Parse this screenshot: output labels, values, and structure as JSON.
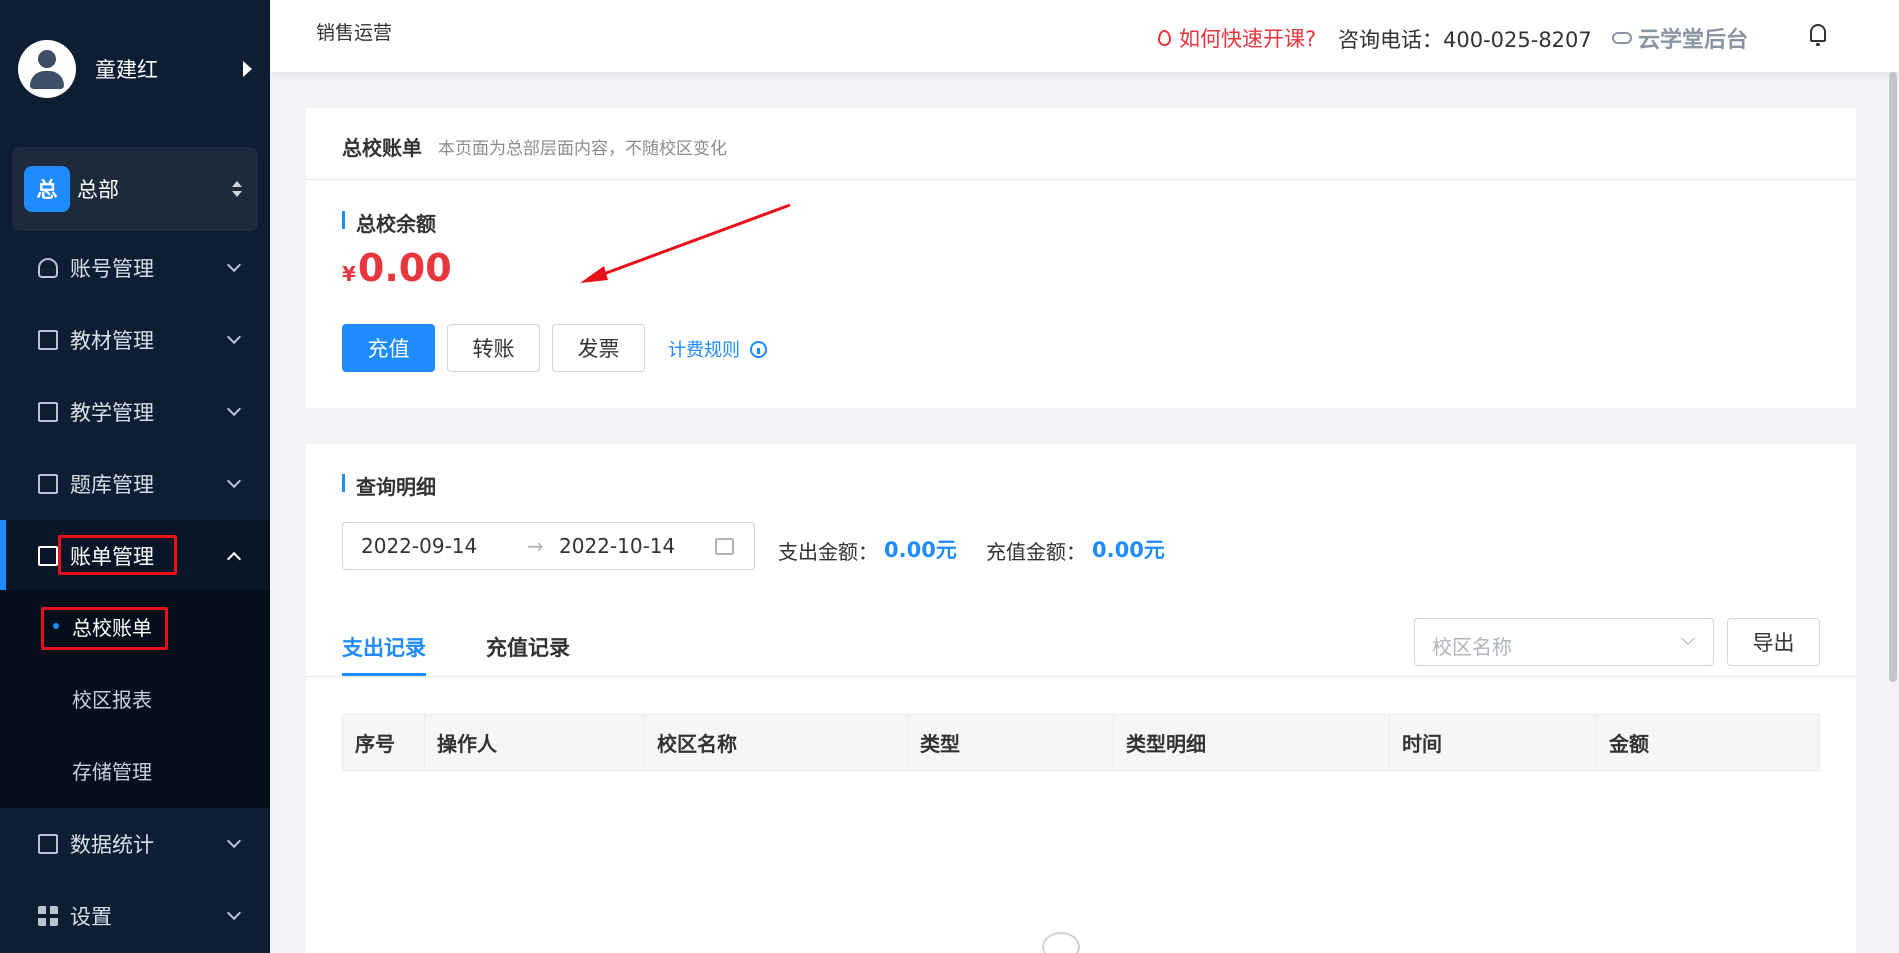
{
  "sidebar": {
    "user_name": "童建红",
    "org": {
      "badge": "总",
      "name": "总部"
    },
    "menu": [
      {
        "label": "账号管理",
        "icon": "user-icon"
      },
      {
        "label": "教材管理",
        "icon": "book-icon"
      },
      {
        "label": "教学管理",
        "icon": "notebook-icon"
      },
      {
        "label": "题库管理",
        "icon": "library-icon"
      },
      {
        "label": "账单管理",
        "icon": "bill-icon"
      },
      {
        "label": "数据统计",
        "icon": "chart-icon"
      },
      {
        "label": "设置",
        "icon": "grid-icon"
      }
    ],
    "submenu": [
      "总校账单",
      "校区报表",
      "存储管理"
    ]
  },
  "header": {
    "title": "销售运营",
    "help_link": "如何快速开课?",
    "phone": "咨询电话：400-025-8207",
    "brand": "云学堂后台"
  },
  "page": {
    "title": "总校账单",
    "desc": "本页面为总部层面内容，不随校区变化"
  },
  "balance": {
    "section_title": "总校余额",
    "currency": "¥",
    "amount": "0.00"
  },
  "actions": {
    "recharge": "充值",
    "transfer": "转账",
    "invoice": "发票",
    "rules": "计费规则"
  },
  "query": {
    "section_title": "查询明细",
    "start_date": "2022-09-14",
    "range_sep": "→",
    "end_date": "2022-10-14",
    "expense_label": "支出金额：",
    "expense_value": "0.00元",
    "recharge_label": "充值金额：",
    "recharge_value": "0.00元"
  },
  "tabs": {
    "expense": "支出记录",
    "recharge": "充值记录"
  },
  "filter": {
    "campus_placeholder": "校区名称",
    "export": "导出"
  },
  "table": {
    "columns": [
      "序号",
      "操作人",
      "校区名称",
      "类型",
      "类型明细",
      "时间",
      "金额"
    ]
  },
  "colors": {
    "accent": "#1e8bff",
    "danger": "#e8363f",
    "sidebar": "#0d1d33"
  }
}
